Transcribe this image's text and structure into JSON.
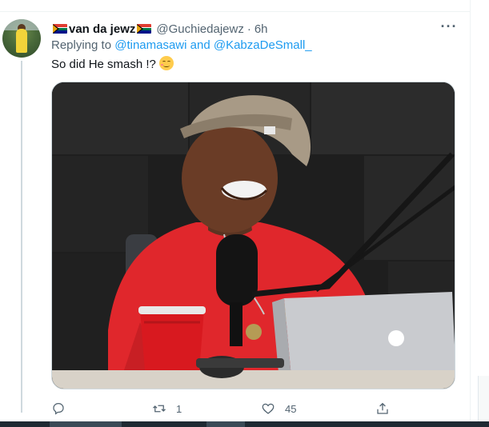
{
  "tweet": {
    "author": {
      "display_name": "van da jewz",
      "handle": "@Guchiedajewz",
      "flag_icon": "south-africa-flag-icon"
    },
    "separator": "·",
    "time": "6h",
    "more_icon": "more-horizontal-icon",
    "more_label": "···",
    "replying": {
      "prefix": "Replying to",
      "mention_1": "@tinamasawi",
      "conjunction": "and",
      "mention_2": "@KabzaDeSmall_"
    },
    "text": "So did He smash !?",
    "emoji_icon": "relieved-face-emoji-icon",
    "media": {
      "alt": "Man in red t-shirt and beige cap speaking into a microphone next to a laptop and red cup"
    },
    "actions": {
      "reply": {
        "icon": "reply-icon",
        "count": ""
      },
      "retweet": {
        "icon": "retweet-icon",
        "count": "1"
      },
      "like": {
        "icon": "heart-icon",
        "count": "45"
      },
      "share": {
        "icon": "share-icon",
        "count": ""
      }
    }
  },
  "colors": {
    "accent": "#1d9bf0",
    "secondary_text": "#536471",
    "primary_text": "#0f1419",
    "shirt_red": "#e0272c"
  }
}
